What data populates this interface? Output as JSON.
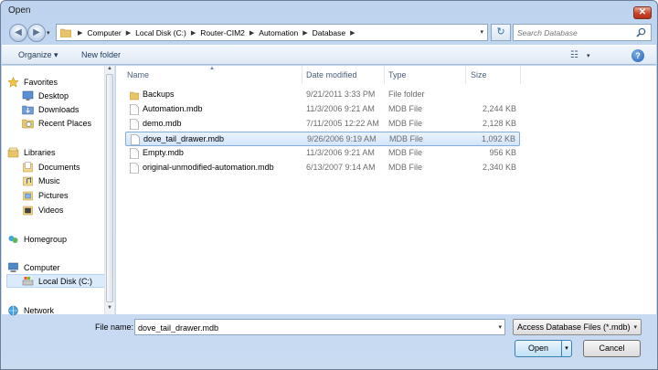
{
  "window": {
    "title": "Open",
    "close_glyph": "✕"
  },
  "nav": {
    "back_glyph": "◀",
    "forward_glyph": "▶",
    "dropdown_glyph": "▾"
  },
  "address": {
    "crumbs": [
      "Computer",
      "Local Disk (C:)",
      "Router-CIM2",
      "Automation",
      "Database"
    ],
    "separator": "▶",
    "dropdown_glyph": "▾",
    "refresh_glyph": "↻"
  },
  "search": {
    "placeholder": "Search Database"
  },
  "toolbar": {
    "organize_label": "Organize ▾",
    "new_folder_label": "New folder",
    "view_glyph": "☷",
    "view_dd_glyph": "▾",
    "help_glyph": "?"
  },
  "navpane": {
    "favorites": "Favorites",
    "desktop": "Desktop",
    "downloads": "Downloads",
    "recent_places": "Recent Places",
    "libraries": "Libraries",
    "documents": "Documents",
    "music": "Music",
    "pictures": "Pictures",
    "videos": "Videos",
    "homegroup": "Homegroup",
    "computer": "Computer",
    "local_disk": "Local Disk (C:)",
    "network": "Network",
    "scroll_up": "▲",
    "scroll_down": "▼"
  },
  "columns": {
    "name": "Name",
    "date": "Date modified",
    "type": "Type",
    "size": "Size",
    "sort_glyph": "▲"
  },
  "files": [
    {
      "name": "Backups",
      "date": "9/21/2011 3:33 PM",
      "type": "File folder",
      "size": "",
      "icon": "folder-icon"
    },
    {
      "name": "Automation.mdb",
      "date": "11/3/2006 9:21 AM",
      "type": "MDB File",
      "size": "2,244 KB",
      "icon": "file-icon"
    },
    {
      "name": "demo.mdb",
      "date": "7/11/2005 12:22 AM",
      "type": "MDB File",
      "size": "2,128 KB",
      "icon": "file-icon"
    },
    {
      "name": "dove_tail_drawer.mdb",
      "date": "9/26/2006 9:19 AM",
      "type": "MDB File",
      "size": "1,092 KB",
      "icon": "file-icon"
    },
    {
      "name": "Empty.mdb",
      "date": "11/3/2006 9:21 AM",
      "type": "MDB File",
      "size": "956 KB",
      "icon": "file-icon"
    },
    {
      "name": "original-unmodified-automation.mdb",
      "date": "6/13/2007 9:14 AM",
      "type": "MDB File",
      "size": "2,340 KB",
      "icon": "file-icon"
    }
  ],
  "selected_file": "dove_tail_drawer.mdb",
  "footer": {
    "file_name_label": "File name:",
    "file_name_value": "dove_tail_drawer.mdb",
    "dropdown_glyph": "▾",
    "file_type": "Access Database Files (*.mdb)",
    "open_label": "Open",
    "open_split_glyph": "▾",
    "cancel_label": "Cancel"
  },
  "colors": {
    "accent": "#1e395b",
    "selection": "#d3e5fb",
    "chrome": "#c9dbf1"
  }
}
